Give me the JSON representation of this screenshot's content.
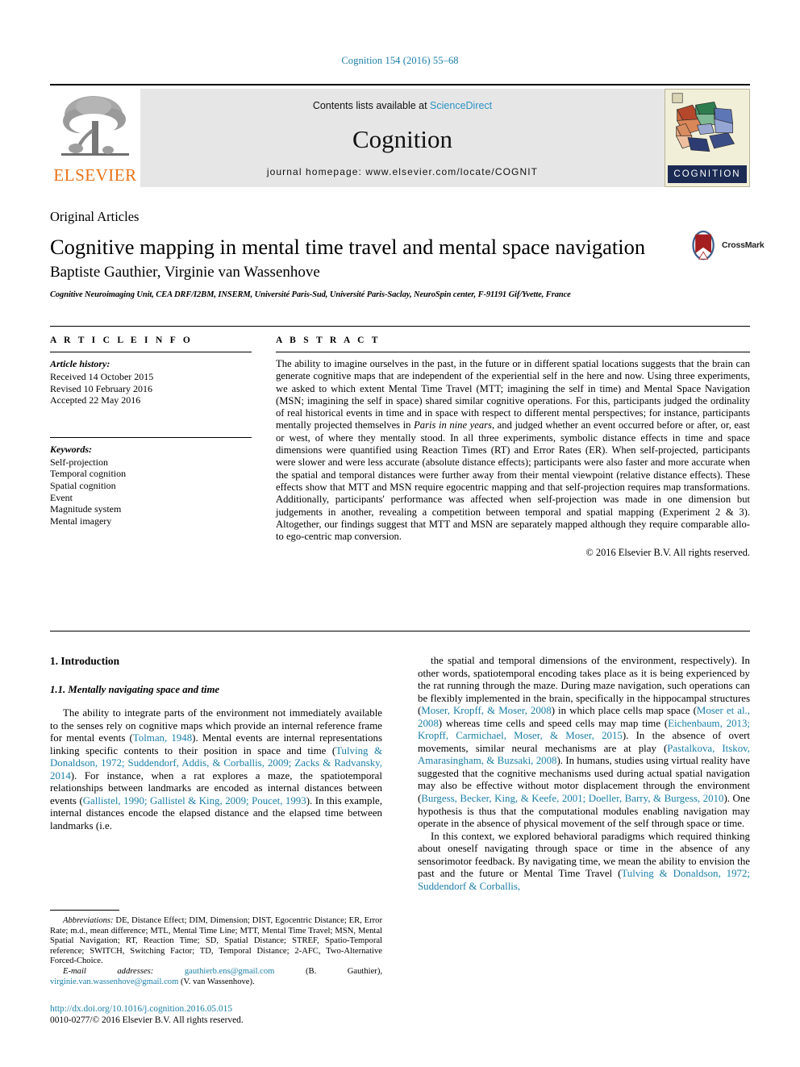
{
  "running_head": "Cognition 154 (2016) 55–68",
  "masthead": {
    "contents_prefix": "Contents lists available at ",
    "sciencedirect": "ScienceDirect",
    "journal_name": "Cognition",
    "homepage": "journal homepage: www.elsevier.com/locate/COGNIT",
    "elsevier_wordmark": "ELSEVIER",
    "cognition_banner": "COGNITION"
  },
  "article": {
    "section_label": "Original Articles",
    "title": "Cognitive mapping in mental time travel and mental space navigation",
    "authors": "Baptiste Gauthier, Virginie van Wassenhove",
    "affiliation": "Cognitive Neuroimaging Unit, CEA DRF/I2BM, INSERM, Université Paris-Sud, Université Paris-Saclay, NeuroSpin center, F-91191 Gif/Yvette, France",
    "crossmark_label": "CrossMark"
  },
  "info": {
    "heading": "A R T I C L E   I N F O",
    "history_label": "Article history:",
    "history": [
      "Received 14 October 2015",
      "Revised 10 February 2016",
      "Accepted 22 May 2016"
    ],
    "keywords_label": "Keywords:",
    "keywords": [
      "Self-projection",
      "Temporal cognition",
      "Spatial cognition",
      "Event",
      "Magnitude system",
      "Mental imagery"
    ]
  },
  "abstract": {
    "heading": "A B S T R A C T",
    "part1": "The ability to imagine ourselves in the past, in the future or in different spatial locations suggests that the brain can generate cognitive maps that are independent of the experiential self in the here and now. Using three experiments, we asked to which extent Mental Time Travel (MTT; imagining the self in time) and Mental Space Navigation (MSN; imagining the self in space) shared similar cognitive operations. For this, participants judged the ordinality of real historical events in time and in space with respect to different mental perspectives; for instance, participants mentally projected themselves in ",
    "italic1": "Paris in nine years",
    "part2": ", and judged whether an event occurred before or after, or, east or west, of where they mentally stood. In all three experiments, symbolic distance effects in time and space dimensions were quantified using Reaction Times (RT) and Error Rates (ER). When self-projected, participants were slower and were less accurate (absolute distance effects); participants were also faster and more accurate when the spatial and temporal distances were further away from their mental viewpoint (relative distance effects). These effects show that MTT and MSN require egocentric mapping and that self-projection requires map transformations. Additionally, participants' performance was affected when self-projection was made in one dimension but judgements in another, revealing a competition between temporal and spatial mapping (Experiment 2 & 3). Altogether, our findings suggest that MTT and MSN are separately mapped although they require comparable allo- to ego-centric map conversion.",
    "copyright": "© 2016 Elsevier B.V. All rights reserved."
  },
  "body": {
    "section_heading": "1. Introduction",
    "subsection_heading": "1.1. Mentally navigating space and time",
    "left_p1_a": "The ability to integrate parts of the environment not immediately available to the senses rely on cognitive maps which provide an internal reference frame for mental events (",
    "left_ref1": "Tolman, 1948",
    "left_p1_b": "). Mental events are internal representations linking specific contents to their position in space and time (",
    "left_ref2": "Tulving & Donaldson, 1972; Suddendorf, Addis, & Corballis, 2009; Zacks & Radvansky, 2014",
    "left_p1_c": "). For instance, when a rat explores a maze, the spatiotemporal relationships between landmarks are encoded as internal distances between events (",
    "left_ref3": "Gallistel, 1990; Gallistel & King, 2009; Poucet, 1993",
    "left_p1_d": "). In this example, internal distances encode the elapsed distance and the elapsed time between landmarks (i.e.",
    "right_p1_a": "the spatial and temporal dimensions of the environment, respectively). In other words, spatiotemporal encoding takes place as it is being experienced by the rat running through the maze. During maze navigation, such operations can be flexibly implemented in the brain, specifically in the hippocampal structures (",
    "right_ref1": "Moser, Kropff, & Moser, 2008",
    "right_p1_b": ") in which place cells map space (",
    "right_ref2": "Moser et al., 2008",
    "right_p1_c": ") whereas time cells and speed cells may map time (",
    "right_ref3": "Eichenbaum, 2013; Kropff, Carmichael, Moser, & Moser, 2015",
    "right_p1_d": "). In the absence of overt movements, similar neural mechanisms are at play (",
    "right_ref4": "Pastalkova, Itskov, Amarasingham, & Buzsaki, 2008",
    "right_p1_e": "). In humans, studies using virtual reality have suggested that the cognitive mechanisms used during actual spatial navigation may also be effective without motor displacement through the environment (",
    "right_ref5": "Burgess, Becker, King, & Keefe, 2001; Doeller, Barry, & Burgess, 2010",
    "right_p1_f": "). One hypothesis is thus that the computational modules enabling navigation may operate in the absence of physical movement of the self through space or time.",
    "right_p2_a": "In this context, we explored behavioral paradigms which required thinking about oneself navigating through space or time in the absence of any sensorimotor feedback. By navigating time, we mean the ability to envision the past and the future or Mental Time Travel (",
    "right_ref6": "Tulving & Donaldson, 1972; Suddendorf & Corballis,"
  },
  "footnote": {
    "abbrev_label": "Abbreviations:",
    "abbrev_text": " DE, Distance Effect; DIM, Dimension; DIST, Egocentric Distance; ER, Error Rate; m.d., mean difference; MTL, Mental Time Line; MTT, Mental Time Travel; MSN, Mental Spatial Navigation; RT, Reaction Time; SD, Spatial Distance; STREF, Spatio-Temporal reference; SWITCH, Switching Factor; TD, Temporal Distance; 2-AFC, Two-Alternative Forced-Choice.",
    "email_label": "E-mail addresses:",
    "email1": "gauthierb.ens@gmail.com",
    "email1_owner": " (B. Gauthier), ",
    "email2": "virginie.van.wassenhove@gmail.com",
    "email2_owner": " (V. van Wassenhove)."
  },
  "doi": {
    "url": "http://dx.doi.org/10.1016/j.cognition.2016.05.015",
    "issn_line": "0010-0277/© 2016 Elsevier B.V. All rights reserved."
  },
  "colors": {
    "link_blue": "#1a7fa8",
    "elsevier_orange": "#E77116",
    "cognition_navy": "#1B2B54",
    "band_gray": "#e6e6e6"
  }
}
